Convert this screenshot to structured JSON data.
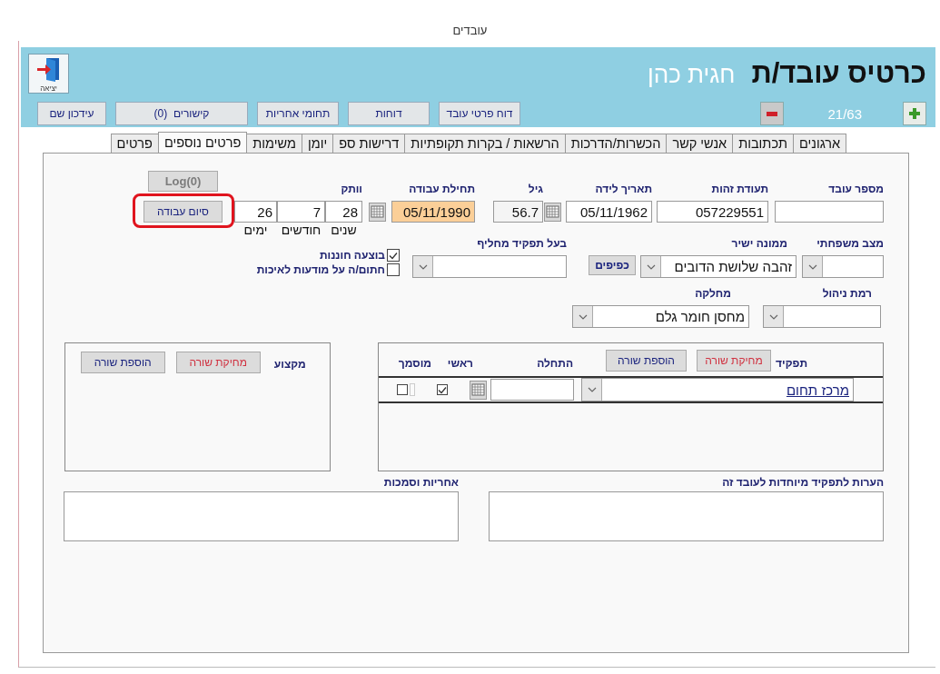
{
  "window": {
    "title": "עובדים"
  },
  "header": {
    "exit_button": "יציאה",
    "title": "כרטיס עובד/ת",
    "employee_name": "חגית כהן",
    "record_counter": "21/63",
    "actions": [
      "דוח פרטי עובד",
      "דוחות",
      "תחומי אחריות",
      "קישורים  (0)",
      "עידכון שם"
    ]
  },
  "tabs": [
    {
      "label": "ארגונים",
      "selected": false
    },
    {
      "label": "תכתובות",
      "selected": false
    },
    {
      "label": "אנשי קשר",
      "selected": false
    },
    {
      "label": "הכשרות/הדרכות",
      "selected": false
    },
    {
      "label": "הרשאות / בקרות תקופתיות",
      "selected": false
    },
    {
      "label": "דרישות ספ",
      "selected": false
    },
    {
      "label": "יומן",
      "selected": false
    },
    {
      "label": "משימות",
      "selected": false
    },
    {
      "label": "פרטים נוספים",
      "selected": true
    },
    {
      "label": "פרטים",
      "selected": false
    }
  ],
  "personal": {
    "employee_number": {
      "label": "מספר עובד"
    },
    "id_number": {
      "label": "תעודת זהות",
      "value": "057229551"
    },
    "birth_date": {
      "label": "תאריך לידה",
      "value": "05/11/1962"
    },
    "age": {
      "label": "גיל",
      "value": "56.7"
    },
    "start_date": {
      "label": "תחילת עבודה",
      "value": "05/11/1990"
    },
    "seniority": {
      "label": "וותק",
      "parts": [
        {
          "unit": "שנים",
          "value": "28"
        },
        {
          "unit": "חודשים",
          "value": "7"
        },
        {
          "unit": "ימים",
          "value": "26"
        }
      ]
    },
    "log_button": {
      "label": "Log(0)",
      "disabled": true
    },
    "end_work_button": {
      "label": "סיום עבודה",
      "highlighted": true
    },
    "marital_status": {
      "label": "מצב משפחתי"
    },
    "direct_manager": {
      "label": "ממונה ישיר",
      "value": "זהבה שלושת הדובים"
    },
    "subordinates_button": "כפיפים",
    "substitute": {
      "label": "בעל תפקיד מחליף"
    },
    "checkboxes": [
      {
        "label": "בוצעה חוננות",
        "checked": true
      },
      {
        "label": "חתום/ה על מודעות לאיכות",
        "checked": false
      }
    ],
    "management_level": {
      "label": "רמת ניהול"
    },
    "department": {
      "label": "מחלקה",
      "value": "מחסן חומר גלם"
    }
  },
  "roles": {
    "label": "תפקיד",
    "delete_button": "מחיקת שורה",
    "add_button": "הוספת שורה",
    "columns": [
      "התחלה",
      "ראשי",
      "מוסמך"
    ],
    "rows": [
      {
        "role": "מרכז תחום",
        "primary": true,
        "certified": false,
        "extra_check_disabled": true
      }
    ]
  },
  "profession": {
    "label": "מקצוע",
    "delete_button": "מחיקת שורה",
    "add_button": "הוספת שורה"
  },
  "notes": [
    {
      "label": "הערות לתפקיד מיוחדות לעובד זה"
    },
    {
      "label": "אחריות וסמכות"
    }
  ]
}
